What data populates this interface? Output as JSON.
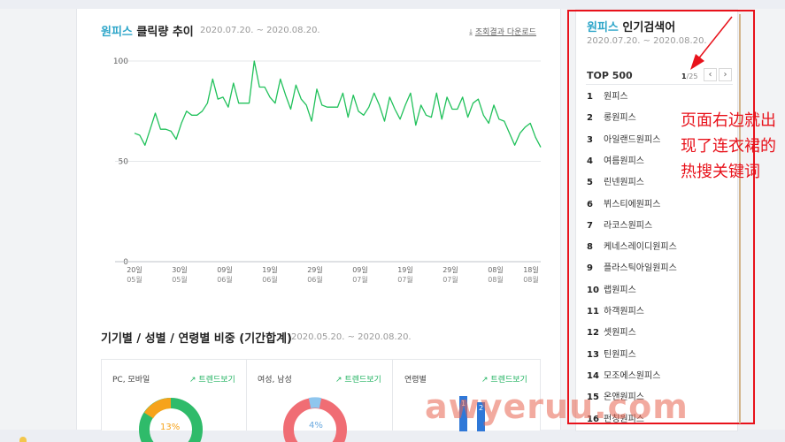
{
  "click_trend": {
    "title_keyword": "원피스",
    "title_rest": " 클릭량 추이",
    "date_range": "2020.07.20. ~ 2020.08.20.",
    "download_icon": "download-icon",
    "download_label": "조회결과 다운로드"
  },
  "chart_data": {
    "type": "line",
    "title": "원피스 클릭량 추이",
    "xlabel": "",
    "ylabel": "",
    "ylim": [
      0,
      100
    ],
    "yticks": [
      0,
      50,
      100
    ],
    "grid": true,
    "line_color": "#21c15b",
    "x_ticks": [
      {
        "day": "20일",
        "month": "05월"
      },
      {
        "day": "30일",
        "month": "05월"
      },
      {
        "day": "09일",
        "month": "06월"
      },
      {
        "day": "19일",
        "month": "06월"
      },
      {
        "day": "29일",
        "month": "06월"
      },
      {
        "day": "09일",
        "month": "07월"
      },
      {
        "day": "19일",
        "month": "07월"
      },
      {
        "day": "29일",
        "month": "07월"
      },
      {
        "day": "08일",
        "month": "08월"
      },
      {
        "day": "18일",
        "month": "08월"
      }
    ],
    "series": [
      {
        "values": [
          64,
          63,
          58,
          66,
          74,
          66,
          66,
          65,
          61,
          69,
          75,
          73,
          73,
          75,
          79,
          91,
          81,
          82,
          77,
          89,
          79,
          79,
          79,
          100,
          87,
          87,
          82,
          79,
          91,
          83,
          76,
          88,
          81,
          78,
          70,
          86,
          78,
          77,
          77,
          77,
          84,
          72,
          83,
          75,
          73,
          77,
          84,
          78,
          70,
          82,
          76,
          71,
          78,
          84,
          68,
          78,
          73,
          72,
          84,
          71,
          82,
          76,
          76,
          82,
          72,
          79,
          81,
          73,
          69,
          78,
          71,
          70,
          64,
          58,
          64,
          67,
          69,
          62,
          57
        ]
      }
    ]
  },
  "ratio_section": {
    "title": "기기별 / 성별 / 연령별 비중 (기간합계)",
    "date_range": "2020.05.20. ~ 2020.08.20.",
    "cards": [
      {
        "label": "PC, 모바일",
        "trend_label": "트렌드보기",
        "pct": "13%"
      },
      {
        "label": "여성, 남성",
        "trend_label": "트렌드보기",
        "pct": "4%"
      },
      {
        "label": "연령별",
        "trend_label": "트렌드보기"
      }
    ],
    "age_bar_labels": [
      "1",
      "2"
    ]
  },
  "popular": {
    "title_keyword": "원피스",
    "title_rest": " 인기검색어",
    "date_range": "2020.07.20. ~ 2020.08.20.",
    "top_label": "TOP 500",
    "page_current": "1",
    "page_total": "/25",
    "prev_symbol": "‹",
    "next_symbol": "›",
    "keywords": [
      {
        "rank": "1",
        "text": "원피스"
      },
      {
        "rank": "2",
        "text": "롱원피스"
      },
      {
        "rank": "3",
        "text": "아일랜드원피스"
      },
      {
        "rank": "4",
        "text": "여름원피스"
      },
      {
        "rank": "5",
        "text": "린넨원피스"
      },
      {
        "rank": "6",
        "text": "뷔스티에원피스"
      },
      {
        "rank": "7",
        "text": "라코스원피스"
      },
      {
        "rank": "8",
        "text": "케네스레이디원피스"
      },
      {
        "rank": "9",
        "text": "플라스틱아일원피스"
      },
      {
        "rank": "10",
        "text": "랩원피스"
      },
      {
        "rank": "11",
        "text": "하객원피스"
      },
      {
        "rank": "12",
        "text": "셋원피스"
      },
      {
        "rank": "13",
        "text": "틴원피스"
      },
      {
        "rank": "14",
        "text": "모조에스원피스"
      },
      {
        "rank": "15",
        "text": "온앤원피스"
      },
      {
        "rank": "16",
        "text": "펀칭원피스"
      }
    ]
  },
  "annotation": {
    "text": "页面右边就出现了连衣裙的热搜关键词",
    "color": "#e8121b"
  },
  "watermark": {
    "part1": "",
    "part2": "awyeruu.com"
  }
}
